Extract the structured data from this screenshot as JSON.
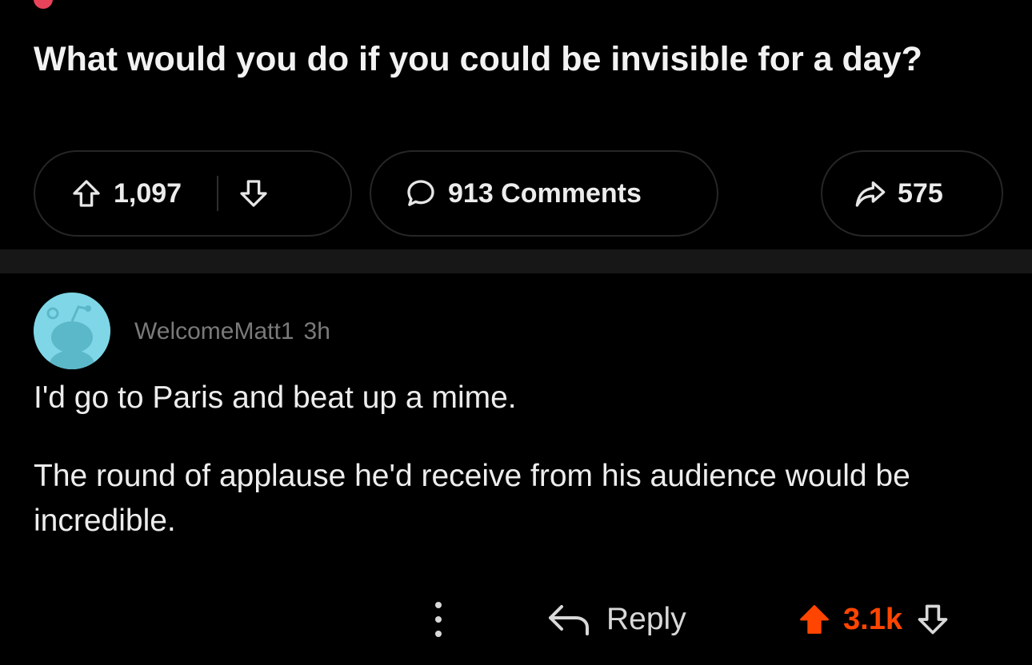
{
  "post": {
    "title": "What would you do if you could be invisible for a day?",
    "upvotes": "1,097",
    "comments_label": "913 Comments",
    "shares": "575"
  },
  "comment": {
    "author": "WelcomeMatt1",
    "age": "3h",
    "paragraphs": [
      "I'd go to Paris and beat up a mime.",
      "The round of applause he'd receive from his audience would be incredible."
    ],
    "reply_label": "Reply",
    "score": "3.1k",
    "vote_state": "upvoted"
  },
  "colors": {
    "background": "#000000",
    "accent_upvote": "#ff4500",
    "subreddit_accent": "#e8435a",
    "avatar": "#7fd6e6"
  },
  "icons": {
    "upvote": "arrow-up-icon",
    "downvote": "arrow-down-icon",
    "comments": "speech-bubble-icon",
    "share": "share-arrow-icon",
    "more": "vertical-ellipsis-icon",
    "reply": "reply-arrow-icon"
  }
}
